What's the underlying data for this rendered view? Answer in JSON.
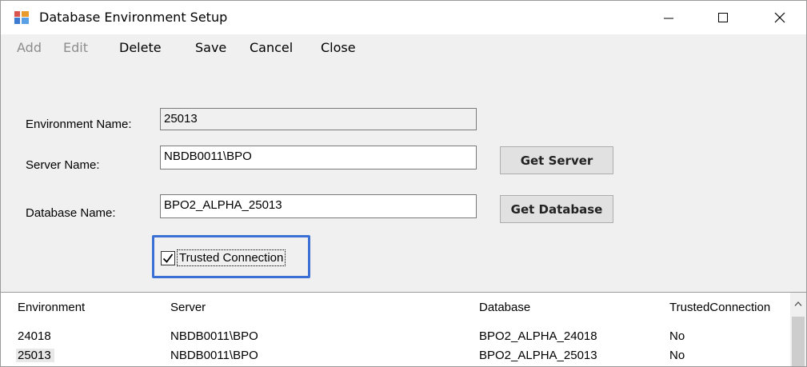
{
  "window": {
    "title": "Database Environment Setup",
    "icon": "app-window-icon"
  },
  "menu": {
    "items": [
      {
        "label": "Add",
        "enabled": false
      },
      {
        "label": "Edit",
        "enabled": false
      },
      {
        "label": "Delete",
        "enabled": true
      },
      {
        "label": "Save",
        "enabled": true
      },
      {
        "label": "Cancel",
        "enabled": true
      },
      {
        "label": "Close",
        "enabled": true
      }
    ]
  },
  "form": {
    "environment_label": "Environment Name:",
    "environment_value": "25013",
    "server_label": "Server Name:",
    "server_value": "NBDB0011\\BPO",
    "database_label": "Database Name:",
    "database_value": "BPO2_ALPHA_25013",
    "get_server_label": "Get Server",
    "get_database_label": "Get Database",
    "trusted_label": "Trusted Connection",
    "trusted_checked": true
  },
  "grid": {
    "columns": [
      "Environment",
      "Server",
      "Database",
      "TrustedConnection"
    ],
    "rows": [
      [
        "24018",
        "NBDB0011\\BPO",
        "BPO2_ALPHA_24018",
        "No"
      ],
      [
        "25013",
        "NBDB0011\\BPO",
        "BPO2_ALPHA_25013",
        "No"
      ]
    ],
    "selected_row": 1
  },
  "colors": {
    "focus_border": "#3b6fd4",
    "window_bg": "#f0f0f0",
    "disabled_text": "#8d8d8d"
  }
}
